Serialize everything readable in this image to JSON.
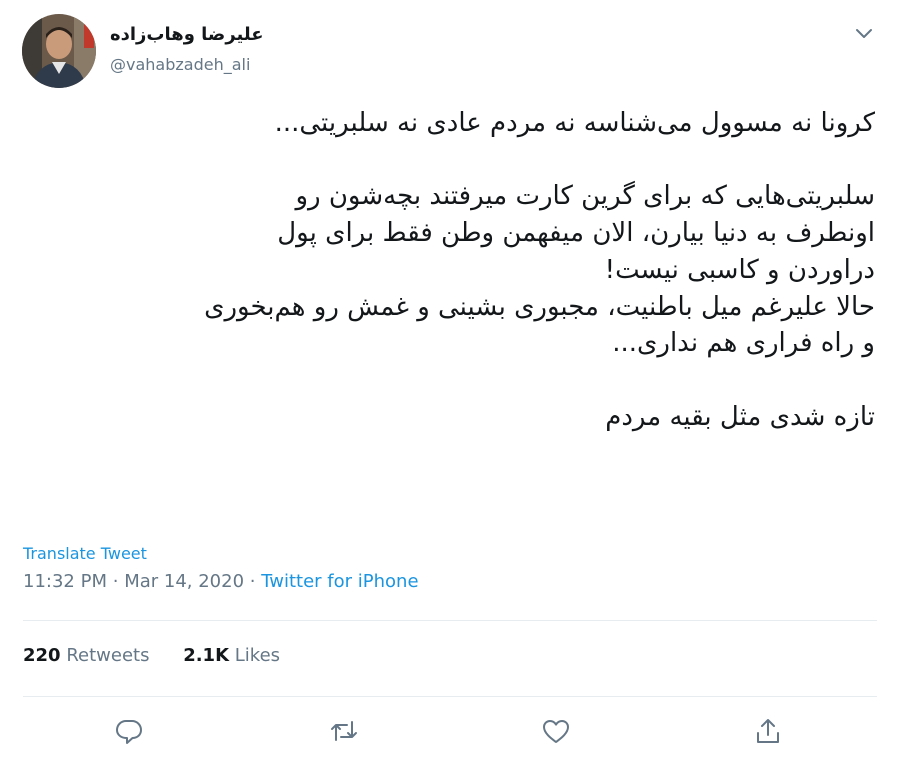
{
  "user": {
    "display_name": "علیرضا وهاب‌زاده",
    "handle": "@vahabzadeh_ali",
    "avatar_icon": "profile-photo"
  },
  "tweet": {
    "lines_1": [
      "کرونا نه مسوول می‌شناسه نه مردم عادی نه سلبریتی..."
    ],
    "lines_2": [
      "سلبریتی‌هایی که برای گرین کارت میرفتند بچه‌شون رو",
      "اونطرف به دنیا بیارن، الان میفهمن وطن فقط برای پول",
      "دراوردن و کاسبی نیست!",
      "حالا علیرغم میل باطنیت، مجبوری بشینی و غمش رو هم‌بخوری",
      "و راه فراری هم نداری..."
    ],
    "lines_3": [
      "تازه شدی مثل بقیه مردم"
    ]
  },
  "translate_label": "Translate Tweet",
  "meta": {
    "time": "11:32 PM",
    "separator": "·",
    "date": "Mar 14, 2020",
    "source": "Twitter for iPhone"
  },
  "stats": {
    "retweets_count": "220",
    "retweets_label": "Retweets",
    "likes_count": "2.1K",
    "likes_label": "Likes"
  },
  "actions": {
    "reply_icon": "reply-icon",
    "retweet_icon": "retweet-icon",
    "like_icon": "like-icon",
    "share_icon": "share-icon"
  },
  "colors": {
    "link": "#1b95e0",
    "secondary": "#657786",
    "primary": "#14171a",
    "divider": "#e6ecf0"
  }
}
